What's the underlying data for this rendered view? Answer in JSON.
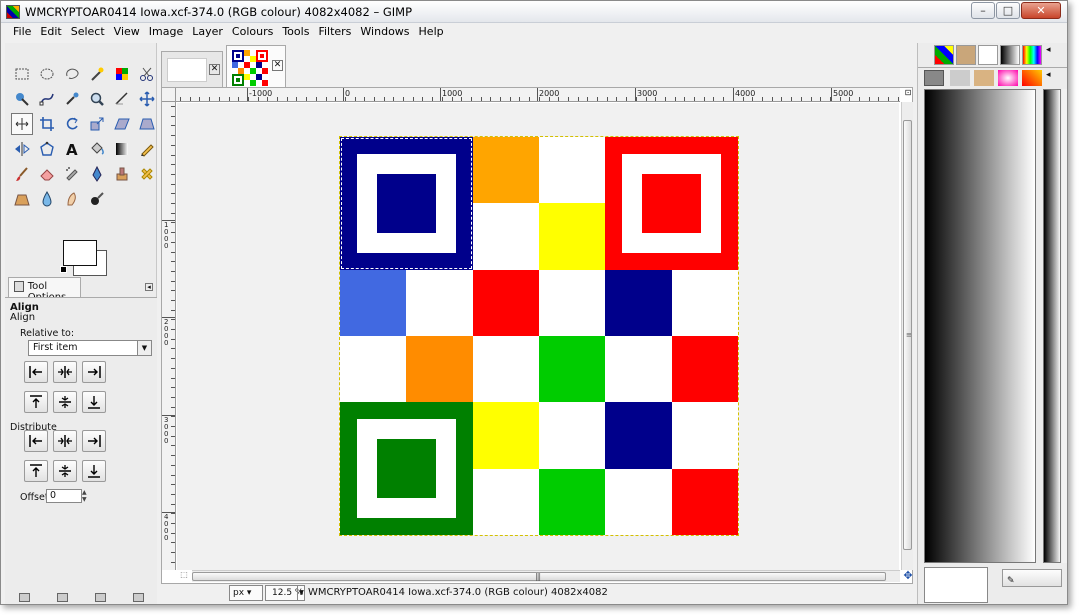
{
  "window": {
    "title": "WMCRYPTOAR0414 Iowa.xcf-374.0 (RGB colour) 4082x4082 – GIMP",
    "controls": {
      "minimize": "–",
      "maximize": "□",
      "close": "✕"
    }
  },
  "menu": [
    "File",
    "Edit",
    "Select",
    "View",
    "Image",
    "Layer",
    "Colours",
    "Tools",
    "Filters",
    "Windows",
    "Help"
  ],
  "toolbox": {
    "tools": [
      "rect-select-icon",
      "ellipse-select-icon",
      "free-select-icon",
      "fuzzy-select-icon",
      "by-color-select-icon",
      "scissors-icon",
      "foreground-select-icon",
      "paths-icon",
      "color-picker-icon",
      "zoom-icon",
      "measure-icon",
      "move-icon",
      "align-icon",
      "crop-icon",
      "rotate-icon",
      "scale-icon",
      "shear-icon",
      "perspective-icon",
      "flip-icon",
      "cage-icon",
      "text-icon",
      "bucket-fill-icon",
      "blend-icon",
      "pencil-icon",
      "paintbrush-icon",
      "eraser-icon",
      "airbrush-icon",
      "ink-icon",
      "clone-icon",
      "heal-icon",
      "perspective-clone-icon",
      "blur-icon",
      "smudge-icon",
      "dodge-burn-icon"
    ],
    "active_tool": "align-icon",
    "colors": {
      "foreground": "#ffffff",
      "background": "#ffffff"
    }
  },
  "tool_options": {
    "tab_label": "Tool Options",
    "heading": "Align",
    "subheading": "Align",
    "relative_label": "Relative to:",
    "relative_value": "First item",
    "distribute_label": "Distribute",
    "offset_label": "Offset:",
    "offset_value": "0"
  },
  "image_tabs": [
    {
      "name": "blank-image-tab",
      "active": false
    },
    {
      "name": "qr-image-tab",
      "active": true
    }
  ],
  "canvas": {
    "ruler_labels": [
      "-1000",
      "0",
      "1000",
      "2000",
      "3000",
      "4000",
      "5000"
    ],
    "vruler_labels": [
      "1000",
      "2000",
      "3000",
      "4000"
    ],
    "qr_cells": [
      [
        "#00008b",
        "#00008b",
        "#ffa500",
        "#ffffff",
        "#ff0000",
        "#ff0000"
      ],
      [
        "#00008b",
        "#00008b",
        "#ffffff",
        "#ffff00",
        "#ff0000",
        "#ff0000"
      ],
      [
        "#4169e1",
        "#ffffff",
        "#ff0000",
        "#ffffff",
        "#00008b",
        "#ffffff"
      ],
      [
        "#ffffff",
        "#ff8c00",
        "#ffffff",
        "#00cc00",
        "#ffffff",
        "#ff0000"
      ],
      [
        "#008000",
        "#008000",
        "#ffff00",
        "#ffffff",
        "#00008b",
        "#ffffff"
      ],
      [
        "#008000",
        "#008000",
        "#ffffff",
        "#00cc00",
        "#ffffff",
        "#ff0000"
      ]
    ],
    "finders": {
      "top_left": "#00008b",
      "top_right": "#ff0000",
      "bottom_left": "#008000"
    }
  },
  "statusbar": {
    "unit": "px",
    "zoom": "12.5 %",
    "text": "WMCRYPTOAR0414 Iowa.xcf-374.0 (RGB colour) 4082x4082"
  }
}
